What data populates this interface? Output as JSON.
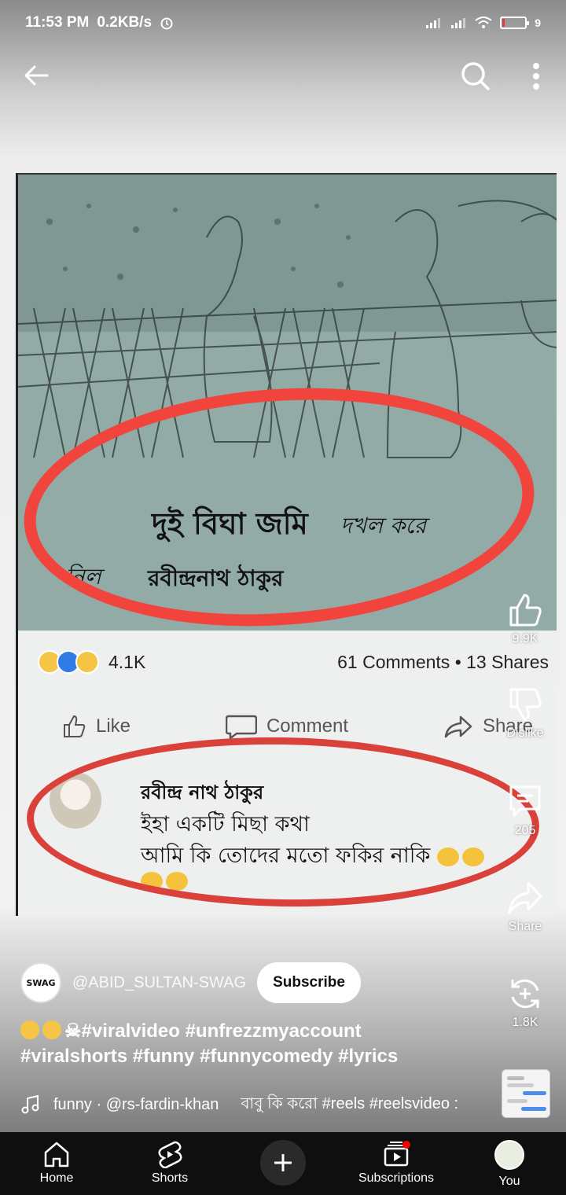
{
  "status_bar": {
    "time": "11:53 PM",
    "speed": "0.2KB/s",
    "battery": "9"
  },
  "top_bar": {
    "back_icon": "arrow-left-icon",
    "search_icon": "search-icon",
    "more_icon": "more-vertical-icon"
  },
  "video": {
    "overlay_title": "দুই বিঘা জমি",
    "overlay_title_suffix": "দখল করে",
    "overlay_author_prefix": "নিল",
    "overlay_author": "রবীন্দ্রনাথ ঠাকুর",
    "reactions_count": "4.1K",
    "comments_shares": "61 Comments • 13 Shares",
    "actions": {
      "like": "Like",
      "comment": "Comment",
      "share": "Share"
    },
    "comment": {
      "name": "রবীন্দ্র নাথ ঠাকুর",
      "line1": "ইহা একটি মিছা কথা",
      "line2": "আমি কি তোদের মতো ফকির নাকি"
    },
    "annotation_color": "#f0443c"
  },
  "rail": {
    "like_count": "9.9K",
    "dislike_label": "Dislike",
    "comment_count": "205",
    "share_label": "Share",
    "remix_count": "1.8K"
  },
  "channel": {
    "avatar_text": "SWAG",
    "handle": "@ABID_SULTAN-SWAG",
    "subscribe_label": "Subscribe"
  },
  "caption": {
    "line1": "#viralvideo  #unfrezzmyaccount",
    "line2": "#viralshorts #funny #funnycomedy #lyrics"
  },
  "music": {
    "track": "funny · @rs-fardin-khan",
    "track2": "বাবু কি করো #reels #reelsvideo :"
  },
  "bottom_nav": {
    "home": "Home",
    "shorts": "Shorts",
    "subscriptions": "Subscriptions",
    "you": "You"
  }
}
